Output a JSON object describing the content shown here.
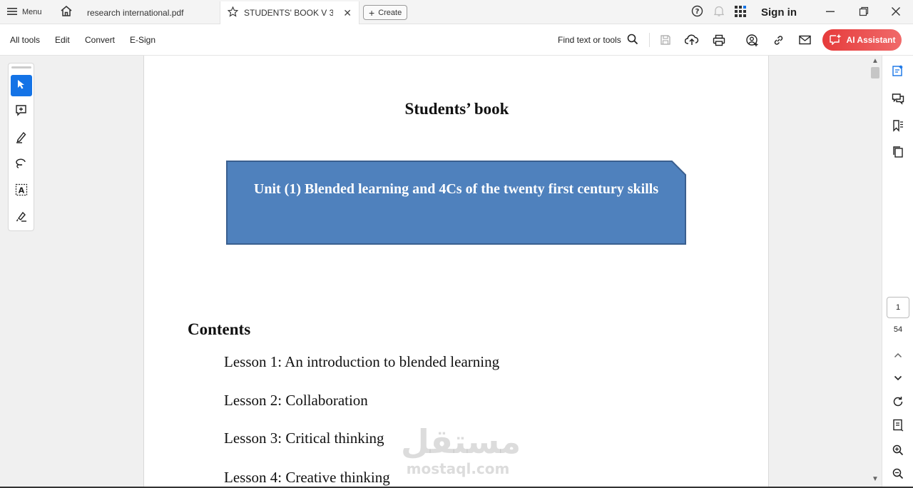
{
  "tabbar": {
    "menu_label": "Menu",
    "tabs": [
      {
        "label": "research international.pdf"
      },
      {
        "label": "STUDENTS' BOOK V 3 - ..."
      }
    ],
    "create_label": "Create",
    "sign_in_label": "Sign in"
  },
  "toolbar": {
    "all_tools": "All tools",
    "edit": "Edit",
    "convert": "Convert",
    "esign": "E-Sign",
    "find": "Find text or tools",
    "ai_assistant": "AI Assistant"
  },
  "document": {
    "title": "Students’ book",
    "unit_title": "Unit (1) Blended learning and 4Cs of the twenty first century skills",
    "contents_heading": "Contents",
    "lessons": [
      "Lesson 1: An introduction to blended learning",
      "Lesson 2: Collaboration",
      "Lesson 3: Critical thinking",
      "Lesson 4: Creative thinking"
    ]
  },
  "watermark": {
    "arabic": "مستقل",
    "latin": "mostaql.com"
  },
  "pagination": {
    "current_page": "1",
    "total_pages": "54"
  },
  "colors": {
    "accent": "#1473e6",
    "ai_button": "#e63b3b",
    "unit_box_fill": "#4f81bd",
    "unit_box_border": "#3a5f8f"
  }
}
